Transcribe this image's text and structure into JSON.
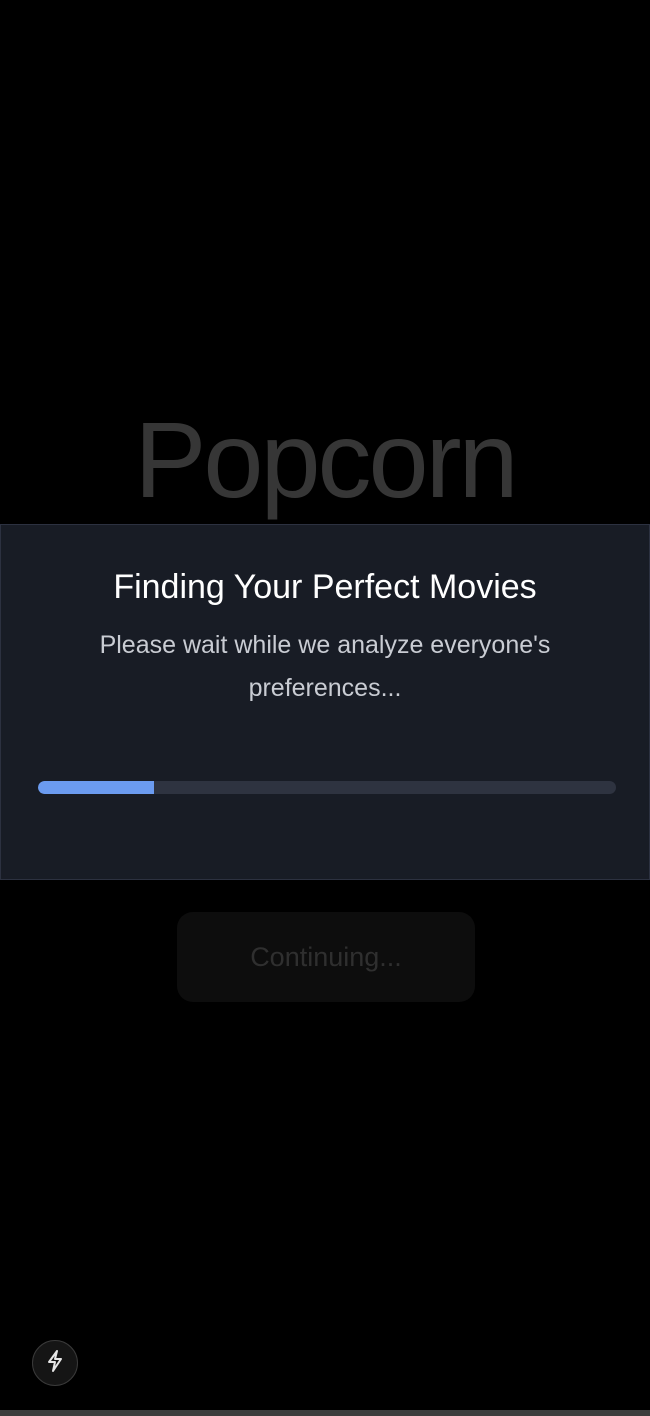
{
  "brand": {
    "name": "Popcorn"
  },
  "modal": {
    "title": "Finding Your Perfect Movies",
    "subtitle": "Please wait while we analyze everyone's preferences...",
    "progress_fraction": 0.2,
    "progress_color": "#6b9bf0"
  },
  "continue_button": {
    "label": "Continuing..."
  },
  "fab": {
    "icon": "lightning-icon"
  },
  "colors": {
    "background": "#000000",
    "modal_background": "#181c25",
    "accent": "#6b9bf0"
  }
}
